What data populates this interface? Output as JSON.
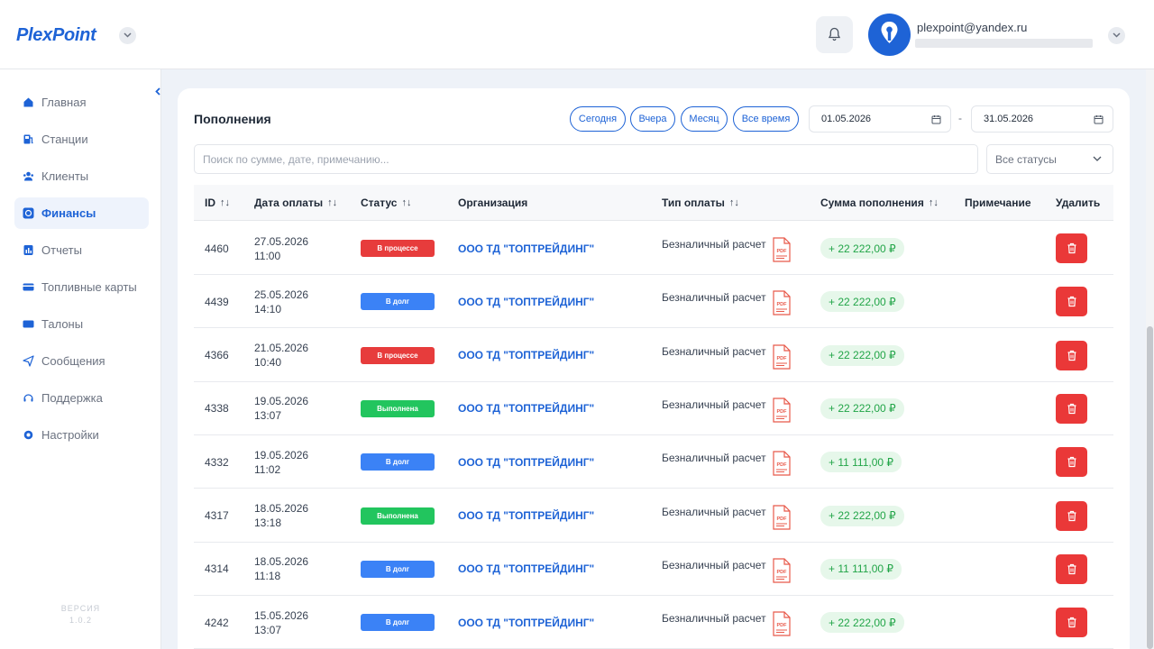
{
  "header": {
    "logo": "PlexPoint",
    "user_email": "plexpoint@yandex.ru"
  },
  "sidebar": {
    "items": [
      {
        "label": "Главная",
        "icon": "home-icon",
        "active": false
      },
      {
        "label": "Станции",
        "icon": "fuel-station-icon",
        "active": false
      },
      {
        "label": "Клиенты",
        "icon": "users-icon",
        "active": false
      },
      {
        "label": "Финансы",
        "icon": "finance-icon",
        "active": true
      },
      {
        "label": "Отчеты",
        "icon": "report-icon",
        "active": false
      },
      {
        "label": "Топливные карты",
        "icon": "card-icon",
        "active": false
      },
      {
        "label": "Талоны",
        "icon": "coupon-icon",
        "active": false
      },
      {
        "label": "Сообщения",
        "icon": "send-icon",
        "active": false
      },
      {
        "label": "Поддержка",
        "icon": "headset-icon",
        "active": false
      },
      {
        "label": "Настройки",
        "icon": "gear-icon",
        "active": false
      }
    ],
    "version_label": "ВЕРСИЯ",
    "version": "1.0.2"
  },
  "main": {
    "title": "Пополнения",
    "filters": [
      "Сегодня",
      "Вчера",
      "Месяц",
      "Все время"
    ],
    "date_from": "01.05.2026",
    "date_sep": "-",
    "date_to": "31.05.2026",
    "search_placeholder": "Поиск по сумме, дате, примечанию...",
    "status_select": "Все статусы"
  },
  "table": {
    "columns": [
      "ID",
      "Дата оплаты",
      "Статус",
      "Организация",
      "Тип оплаты",
      "Сумма пополнения",
      "Примечание",
      "Удалить"
    ],
    "sort_glyph": "↑↓",
    "pdf_label": "PDF",
    "rows": [
      {
        "id": "4460",
        "date": "27.05.2026",
        "time": "11:00",
        "status": "В процессе",
        "status_color": "#e73c3c",
        "org": "ООО ТД \"ТОПТРЕЙДИНГ\"",
        "pay_type": "Безналичный расчет",
        "sum": "+ 22 222,00 ₽",
        "note": ""
      },
      {
        "id": "4439",
        "date": "25.05.2026",
        "time": "14:10",
        "status": "В долг",
        "status_color": "#3b82f6",
        "org": "ООО ТД \"ТОПТРЕЙДИНГ\"",
        "pay_type": "Безналичный расчет",
        "sum": "+ 22 222,00 ₽",
        "note": ""
      },
      {
        "id": "4366",
        "date": "21.05.2026",
        "time": "10:40",
        "status": "В процессе",
        "status_color": "#e73c3c",
        "org": "ООО ТД \"ТОПТРЕЙДИНГ\"",
        "pay_type": "Безналичный расчет",
        "sum": "+ 22 222,00 ₽",
        "note": ""
      },
      {
        "id": "4338",
        "date": "19.05.2026",
        "time": "13:07",
        "status": "Выполнена",
        "status_color": "#22c55e",
        "org": "ООО ТД \"ТОПТРЕЙДИНГ\"",
        "pay_type": "Безналичный расчет",
        "sum": "+ 22 222,00 ₽",
        "note": ""
      },
      {
        "id": "4332",
        "date": "19.05.2026",
        "time": "11:02",
        "status": "В долг",
        "status_color": "#3b82f6",
        "org": "ООО ТД \"ТОПТРЕЙДИНГ\"",
        "pay_type": "Безналичный расчет",
        "sum": "+ 11 111,00 ₽",
        "note": ""
      },
      {
        "id": "4317",
        "date": "18.05.2026",
        "time": "13:18",
        "status": "Выполнена",
        "status_color": "#22c55e",
        "org": "ООО ТД \"ТОПТРЕЙДИНГ\"",
        "pay_type": "Безналичный расчет",
        "sum": "+ 22 222,00 ₽",
        "note": ""
      },
      {
        "id": "4314",
        "date": "18.05.2026",
        "time": "11:18",
        "status": "В долг",
        "status_color": "#3b82f6",
        "org": "ООО ТД \"ТОПТРЕЙДИНГ\"",
        "pay_type": "Безналичный расчет",
        "sum": "+ 11 111,00 ₽",
        "note": ""
      },
      {
        "id": "4242",
        "date": "15.05.2026",
        "time": "13:07",
        "status": "В долг",
        "status_color": "#3b82f6",
        "org": "ООО ТД \"ТОПТРЕЙДИНГ\"",
        "pay_type": "Безналичный расчет",
        "sum": "+ 22 222,00 ₽",
        "note": ""
      }
    ]
  },
  "colors": {
    "accent": "#1e63d6",
    "danger": "#ea3838",
    "success_bg": "#e6f7ea",
    "success_text": "#22a548"
  }
}
